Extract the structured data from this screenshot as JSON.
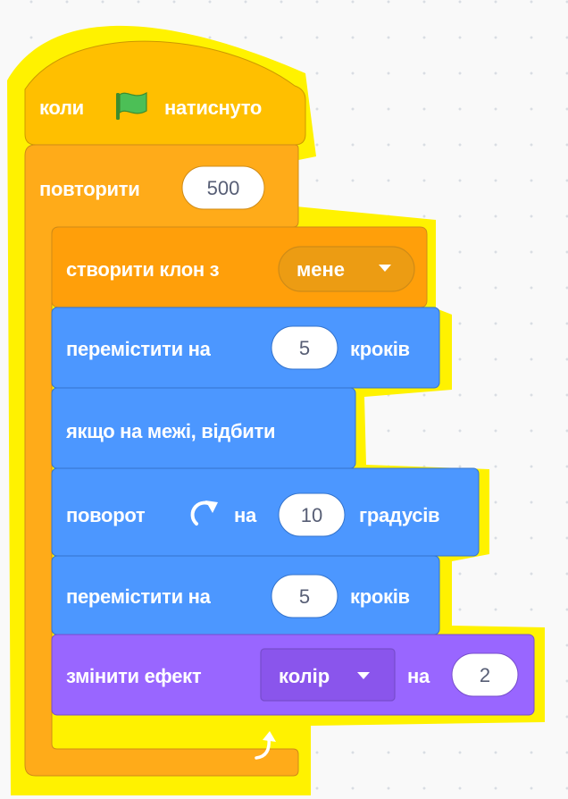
{
  "colors": {
    "events": "#ffbf00",
    "control": "#ffab19",
    "control_inner": "#ff9f0a",
    "motion": "#4c97ff",
    "looks": "#9966ff",
    "glow": "#fff200",
    "input_text": "#575e75"
  },
  "script": {
    "hat": {
      "before_label": "коли",
      "icon": "green-flag-icon",
      "after_label": "натиснуто"
    },
    "repeat": {
      "label": "повторити",
      "times": "500",
      "end_icon": "loop-arrow-icon",
      "body": {
        "create_clone": {
          "label": "створити клон з",
          "option": "мене"
        },
        "move_1": {
          "before_label": "перемістити на",
          "steps": "5",
          "after_label": "кроків"
        },
        "bounce": {
          "label": "якщо на межі, відбити"
        },
        "turn": {
          "before_label": "поворот",
          "icon": "rotate-right-icon",
          "middle_label": "на",
          "degrees": "10",
          "after_label": "градусів"
        },
        "move_2": {
          "before_label": "перемістити на",
          "steps": "5",
          "after_label": "кроків"
        },
        "change_effect": {
          "before_label": "змінити ефект",
          "effect": "колір",
          "middle_label": "на",
          "value": "2"
        }
      }
    }
  }
}
